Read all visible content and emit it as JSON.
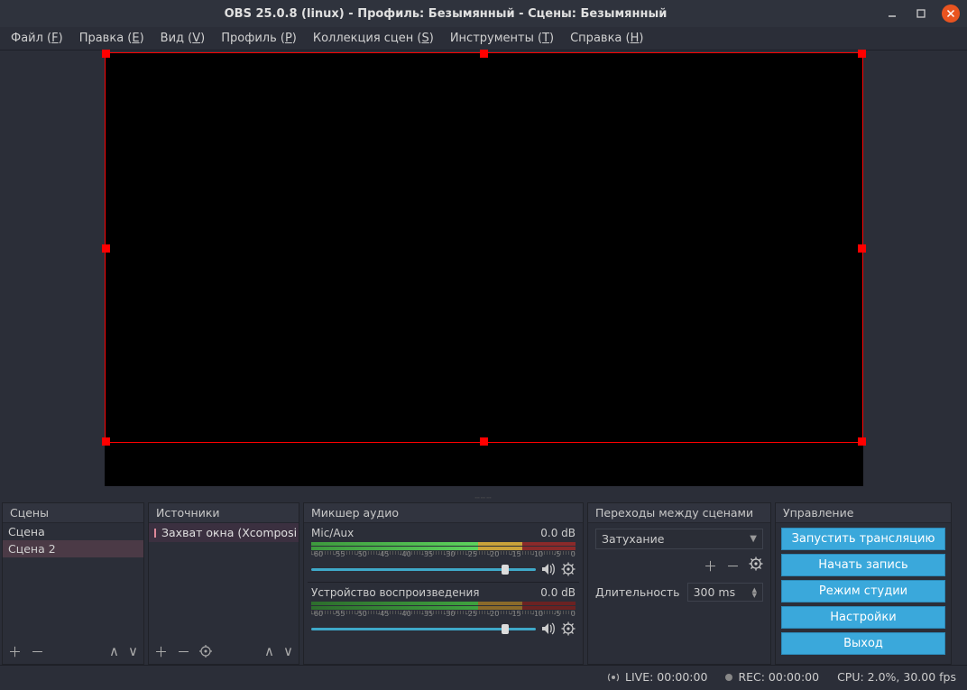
{
  "window": {
    "title": "OBS 25.0.8 (linux) - Профиль: Безымянный - Сцены: Безымянный"
  },
  "menu": {
    "file": "Файл (F)",
    "edit": "Правка (E)",
    "view": "Вид (V)",
    "profile": "Профиль (P)",
    "scenes": "Коллекция сцен (S)",
    "tools": "Инструменты (T)",
    "help": "Справка (H)"
  },
  "panels": {
    "scenes_title": "Сцены",
    "sources_title": "Источники",
    "mixer_title": "Микшер аудио",
    "transitions_title": "Переходы между сценами",
    "controls_title": "Управление"
  },
  "scenes": [
    {
      "name": "Сцена"
    },
    {
      "name": "Сцена 2"
    }
  ],
  "sources": [
    {
      "name": "Захват окна (Xcomposi"
    }
  ],
  "mixer": {
    "items": [
      {
        "name": "Mic/Aux",
        "level": "0.0 dB"
      },
      {
        "name": "Устройство воспроизведения",
        "level": "0.0 dB"
      }
    ],
    "ticks": [
      "-60",
      "-55",
      "-50",
      "-45",
      "-40",
      "-35",
      "-30",
      "-25",
      "-20",
      "-15",
      "-10",
      "-5",
      "0"
    ]
  },
  "transitions": {
    "selected": "Затухание",
    "duration_label": "Длительность",
    "duration_value": "300 ms"
  },
  "controls": {
    "start_stream": "Запустить трансляцию",
    "start_record": "Начать запись",
    "studio_mode": "Режим студии",
    "settings": "Настройки",
    "exit": "Выход"
  },
  "status": {
    "live": "LIVE: 00:00:00",
    "rec": "REC: 00:00:00",
    "cpu": "CPU: 2.0%, 30.00 fps"
  }
}
